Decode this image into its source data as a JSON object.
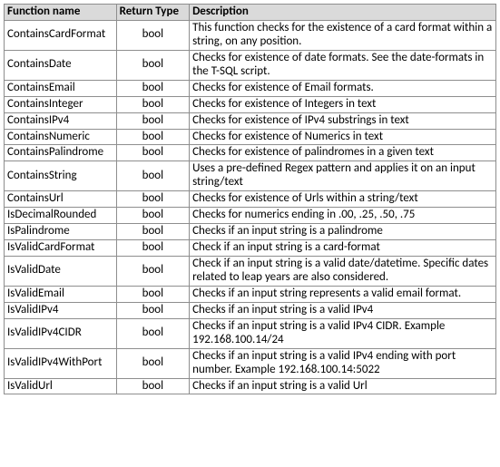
{
  "table": {
    "headers": {
      "name": "Function name",
      "ret": "Return Type",
      "desc": "Description"
    },
    "rows": [
      {
        "name": "ContainsCardFormat",
        "ret": "bool",
        "desc": "This function checks for the existence of a card format within a string, on any position."
      },
      {
        "name": "ContainsDate",
        "ret": "bool",
        "desc": "Checks for existence of date formats. See the date-formats in the T-SQL script."
      },
      {
        "name": "ContainsEmail",
        "ret": "bool",
        "desc": "Checks for existence of Email formats."
      },
      {
        "name": "ContainsInteger",
        "ret": "bool",
        "desc": "Checks for existence of Integers in text"
      },
      {
        "name": "ContainsIPv4",
        "ret": "bool",
        "desc": "Checks for existence of IPv4 substrings in text"
      },
      {
        "name": "ContainsNumeric",
        "ret": "bool",
        "desc": "Checks for existence of Numerics in text"
      },
      {
        "name": "ContainsPalindrome",
        "ret": "bool",
        "desc": "Checks for existence of palindromes in a given text"
      },
      {
        "name": "ContainsString",
        "ret": "bool",
        "desc": "Uses a pre-defined Regex pattern and applies it on an input string/text"
      },
      {
        "name": "ContainsUrl",
        "ret": "bool",
        "desc": "Checks for existence of Urls within a string/text"
      },
      {
        "name": "IsDecimalRounded",
        "ret": "bool",
        "desc": "Checks for numerics ending in .00, .25, .50, .75"
      },
      {
        "name": "IsPalindrome",
        "ret": "bool",
        "desc": "Checks if an input string is a palindrome"
      },
      {
        "name": "IsValidCardFormat",
        "ret": "bool",
        "desc": "Check if an input string is a card-format"
      },
      {
        "name": "IsValidDate",
        "ret": "bool",
        "desc": "Check if an input string is a valid date/datetime. Specific dates related to leap years are also considered."
      },
      {
        "name": "IsValidEmail",
        "ret": "bool",
        "desc": "Checks if an input string represents a valid email format."
      },
      {
        "name": "IsValidIPv4",
        "ret": "bool",
        "desc": "Checks if an input string is a valid IPv4"
      },
      {
        "name": "IsValidIPv4CIDR",
        "ret": "bool",
        "desc": "Checks if an input string is a valid IPv4 CIDR. Example 192.168.100.14/24"
      },
      {
        "name": "IsValidIPv4WithPort",
        "ret": "bool",
        "desc": "Checks if an input string is a valid IPv4 ending with port number. Example 192.168.100.14:5022"
      },
      {
        "name": "IsValidUrl",
        "ret": "bool",
        "desc": "Checks if an input string is a valid Url"
      }
    ]
  }
}
